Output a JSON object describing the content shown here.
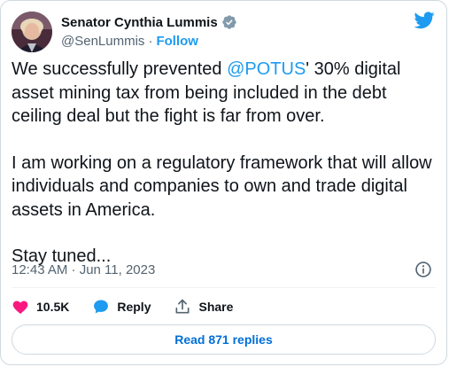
{
  "author": {
    "display_name": "Senator Cynthia Lummis",
    "handle": "@SenLummis",
    "separator": "·",
    "follow_label": "Follow"
  },
  "tweet": {
    "p1_before": "We successfully prevented ",
    "p1_mention": "@POTUS",
    "p1_after": "' 30% digital asset mining tax from being included in the debt ceiling deal but the fight is far from over.",
    "p2": "I am working on a regulatory framework that will allow individuals and companies to own and trade digital assets in America.",
    "p3": "Stay tuned..."
  },
  "meta": {
    "timestamp": "12:43 AM · Jun 11, 2023"
  },
  "actions": {
    "likes": "10.5K",
    "reply_label": "Reply",
    "share_label": "Share"
  },
  "replies_button": "Read 871 replies",
  "colors": {
    "accent": "#1d9bf0",
    "like": "#f91880",
    "verified": "#829aab",
    "text": "#0f1419",
    "muted": "#536471"
  },
  "icons": [
    "verified-badge-icon",
    "twitter-bird-icon",
    "info-icon",
    "heart-icon",
    "reply-bubble-icon",
    "share-icon"
  ]
}
